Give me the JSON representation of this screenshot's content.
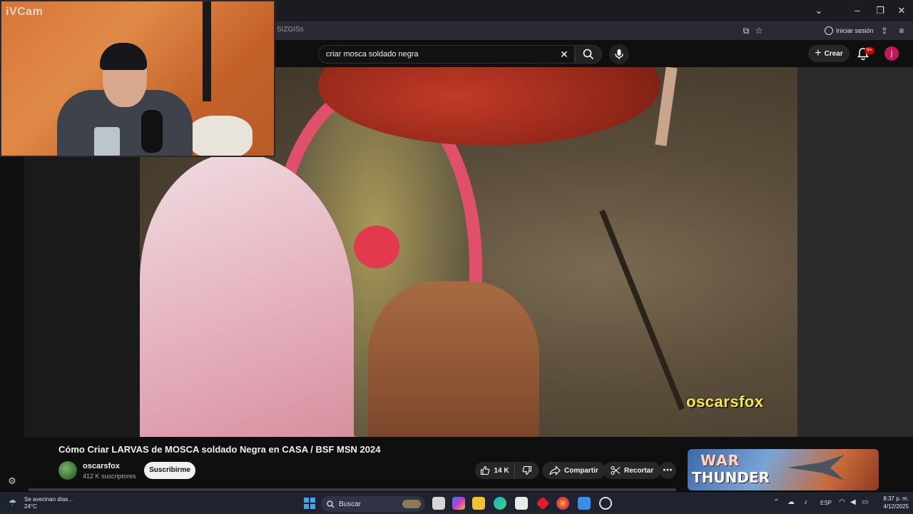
{
  "browser": {
    "url_fragment": "SIZGISs",
    "signin_label": "Iniciar sesión"
  },
  "webcam": {
    "label": "iVCam"
  },
  "youtube": {
    "search_value": "criar mosca soldado negra",
    "create_label": "Crear",
    "notification_count": "9+",
    "avatar_initial": "j"
  },
  "video": {
    "watermark": "oscarsfox",
    "title": "Cómo Criar LARVAS de MOSCA soldado Negra en CASA / BSF MSN 2024",
    "channel_name": "oscarsfox",
    "subscribers": "412 K suscriptores",
    "subscribe_label": "Suscribirme",
    "likes": "14 K",
    "share_label": "Compartir",
    "clip_label": "Recortar"
  },
  "ad": {
    "line1": "WAR",
    "line2": "THUNDER"
  },
  "taskbar": {
    "weather_text": "Se avecinan días...",
    "temperature": "24°C",
    "search_label": "Buscar",
    "language": "ESP",
    "time": "8:37 p. m.",
    "date": "4/12/2025"
  },
  "colors": {
    "youtube_red": "#cc0000",
    "watermark_yellow": "#f4e54a",
    "windows_blue": "#3ca6f0"
  }
}
